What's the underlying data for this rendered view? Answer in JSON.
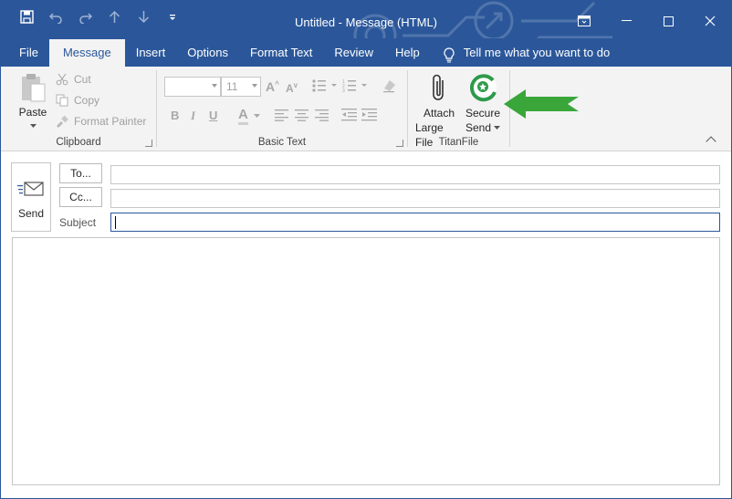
{
  "window": {
    "title": "Untitled  -  Message (HTML)",
    "controls": {
      "minimize": "—",
      "maximize": "☐",
      "close": "✕"
    }
  },
  "qat": {
    "save_icon": "save-icon",
    "undo_icon": "undo-icon",
    "redo_icon": "redo-icon",
    "up_icon": "up-arrow-icon",
    "down_icon": "down-arrow-icon",
    "customize_icon": "customize-qat-icon"
  },
  "tabs": [
    {
      "label": "File"
    },
    {
      "label": "Message"
    },
    {
      "label": "Insert"
    },
    {
      "label": "Options"
    },
    {
      "label": "Format Text"
    },
    {
      "label": "Review"
    },
    {
      "label": "Help"
    }
  ],
  "tell_me": "Tell me what you want to do",
  "ribbon": {
    "clipboard": {
      "label": "Clipboard",
      "paste": "Paste",
      "cut": "Cut",
      "copy": "Copy",
      "format_painter": "Format Painter"
    },
    "basic_text": {
      "label": "Basic Text",
      "font_name": "",
      "font_size": "11",
      "bold": "B",
      "italic": "I",
      "underline": "U",
      "font_color": "A"
    },
    "titanfile": {
      "label": "TitanFile",
      "attach_line1": "Attach",
      "attach_line2": "Large File",
      "secure_line1": "Secure",
      "secure_line2": "Send"
    }
  },
  "compose": {
    "send": "Send",
    "to_button": "To...",
    "cc_button": "Cc...",
    "subject_label": "Subject",
    "to_value": "",
    "cc_value": "",
    "subject_value": ""
  },
  "colors": {
    "brand_blue": "#2b579a",
    "ribbon_bg": "#f3f3f3",
    "callout_green": "#3aa63a"
  }
}
